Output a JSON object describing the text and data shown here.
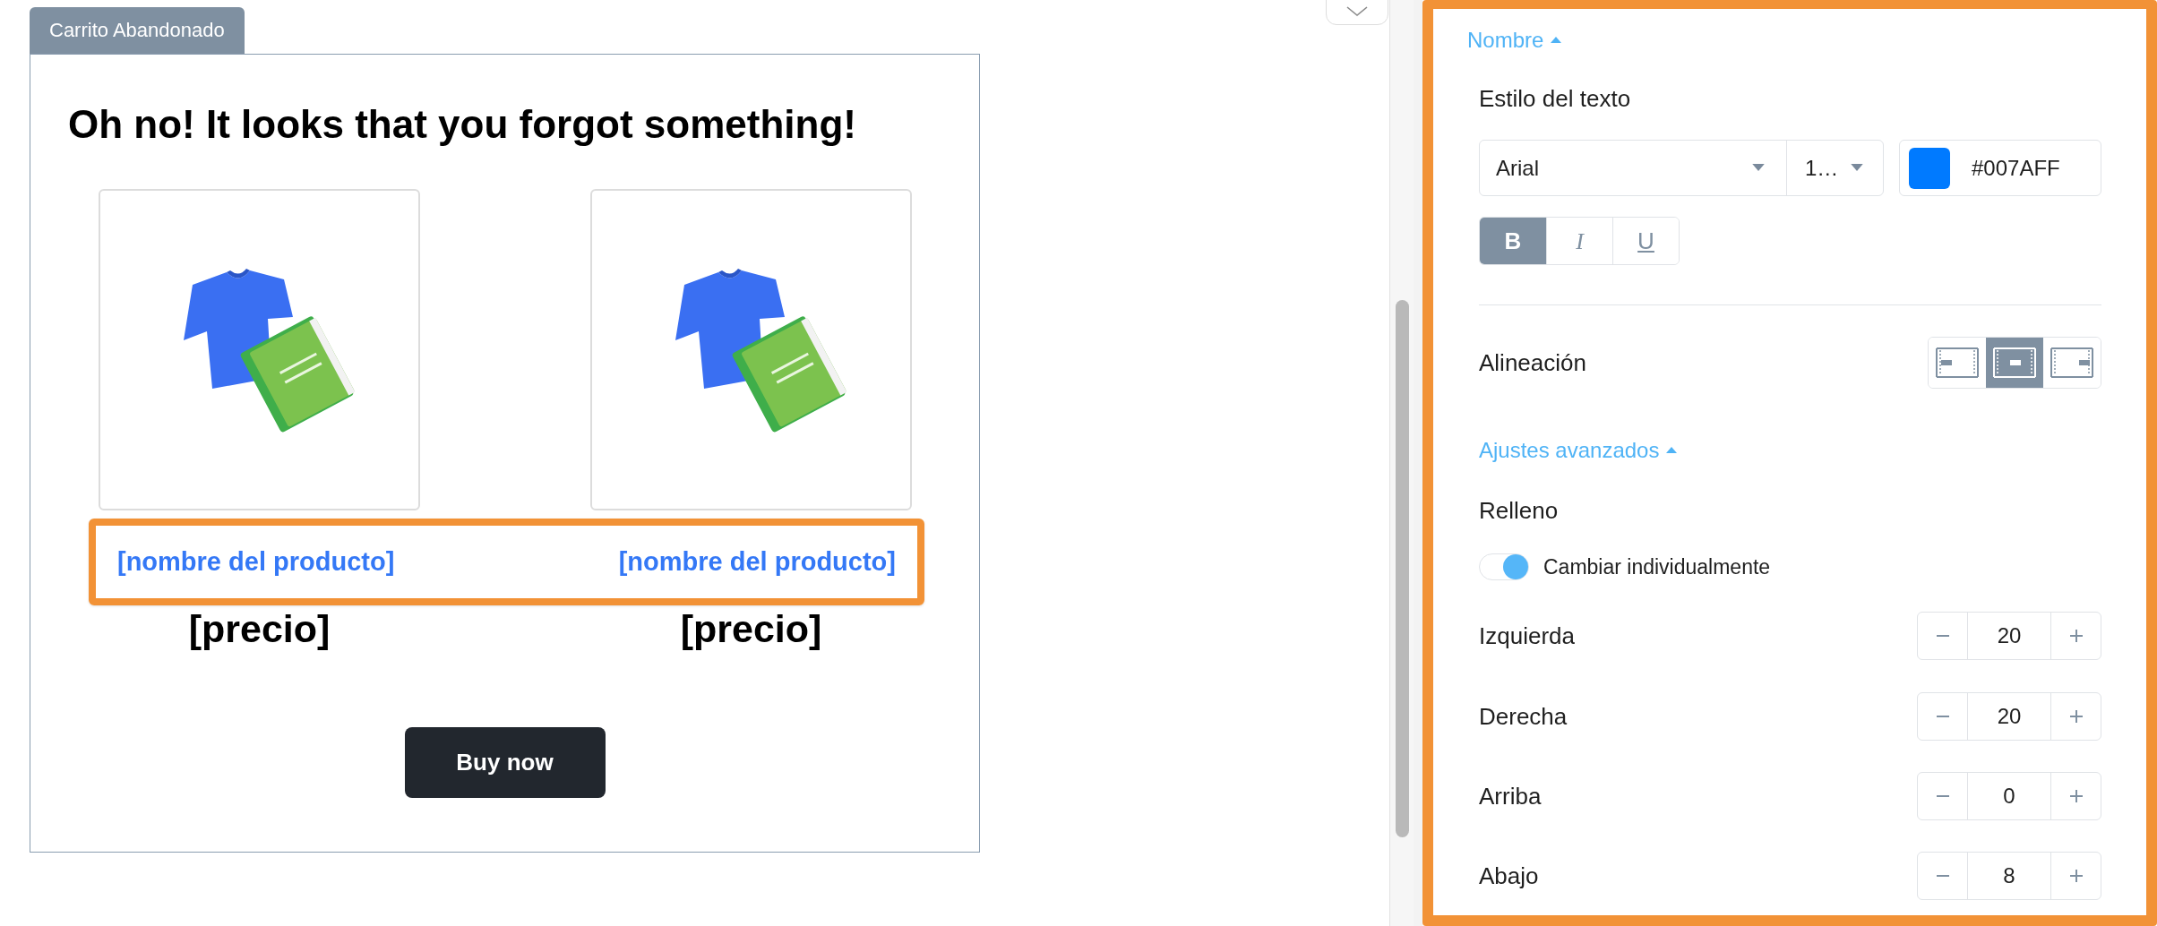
{
  "tab": {
    "label": "Carrito Abandonado"
  },
  "email": {
    "heading": "Oh no! It looks that you forgot something!",
    "products": [
      {
        "name": "[nombre del producto]",
        "price": "[precio]"
      },
      {
        "name": "[nombre del producto]",
        "price": "[precio]"
      }
    ],
    "button": "Buy now"
  },
  "editor": {
    "section": {
      "label": "Nombre",
      "expanded": true
    },
    "text_style": {
      "label": "Estilo del texto",
      "font": "Arial",
      "size": "1…",
      "color": "#007AFF",
      "formats": [
        {
          "label": "B",
          "kind": "bold",
          "selected": true
        },
        {
          "label": "I",
          "kind": "italic",
          "selected": false
        },
        {
          "label": "U",
          "kind": "underline",
          "selected": false
        }
      ]
    },
    "alignment": {
      "label": "Alineación",
      "options": [
        {
          "kind": "left",
          "selected": false
        },
        {
          "kind": "center",
          "selected": true
        },
        {
          "kind": "right",
          "selected": false
        }
      ]
    },
    "advanced": {
      "label": "Ajustes avanzados",
      "expanded": true
    },
    "padding": {
      "label": "Relleno",
      "toggle": {
        "label": "Cambiar individualmente",
        "on": true
      },
      "fields": [
        {
          "label": "Izquierda",
          "value": "20"
        },
        {
          "label": "Derecha",
          "value": "20"
        },
        {
          "label": "Arriba",
          "value": "0"
        },
        {
          "label": "Abajo",
          "value": "8"
        }
      ]
    }
  }
}
